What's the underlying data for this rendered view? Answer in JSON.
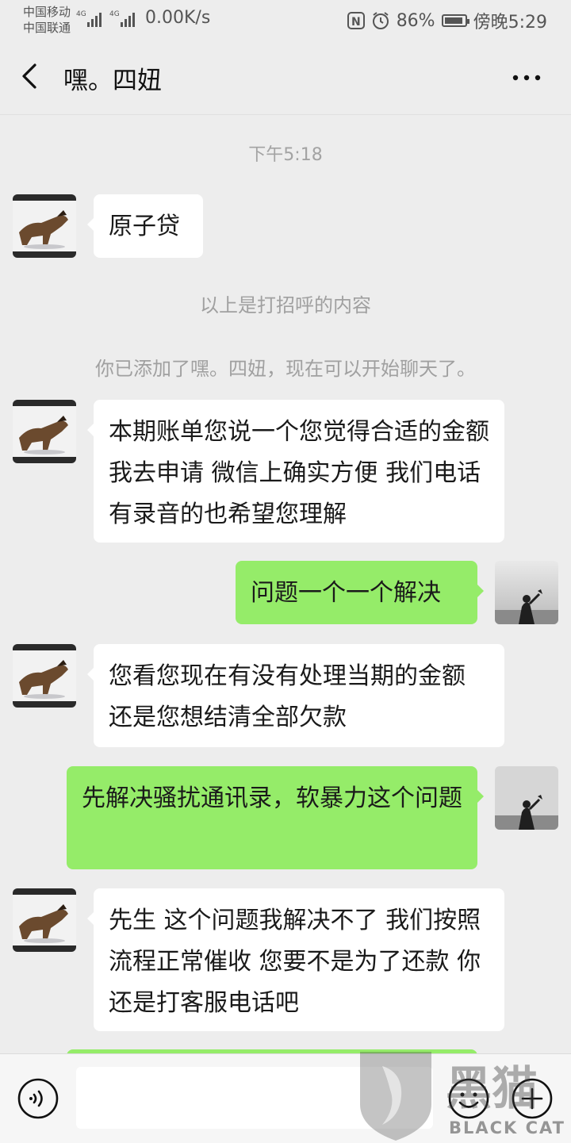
{
  "status": {
    "carrier1": "中国移动",
    "carrier2": "中国联通",
    "network": "0.00K/s",
    "battery": "86%",
    "time": "傍晚5:29"
  },
  "header": {
    "title": "嘿。四妞"
  },
  "chat": {
    "timestamp": "下午5:18",
    "greeting_bubble": "原子贷",
    "system1": "以上是打招呼的内容",
    "system2": "你已添加了嘿。四妞，现在可以开始聊天了。",
    "msg1": "本期账单您说一个您觉得合适的金额 我去申请 微信上确实方便 我们电话有录音的也希望您理解",
    "msg2": "问题一个一个解决",
    "msg3": "您看您现在有没有处理当期的金额 还是您想结清全部欠款",
    "msg4": "先解决骚扰通讯录，软暴力这个问题",
    "msg5": "先生 这个问题我解决不了 我们按照流程正常催收 您要不是为了还款 你还是打客服电话吧"
  },
  "watermark": {
    "chinese": "黑猫",
    "english": "BLACK CAT"
  },
  "icons": [
    "back-icon",
    "more-icon",
    "voice-icon",
    "emoji-icon",
    "plus-icon"
  ],
  "colors": {
    "background": "#ededed",
    "outgoing_bubble": "#95ec69",
    "incoming_bubble": "#ffffff"
  }
}
